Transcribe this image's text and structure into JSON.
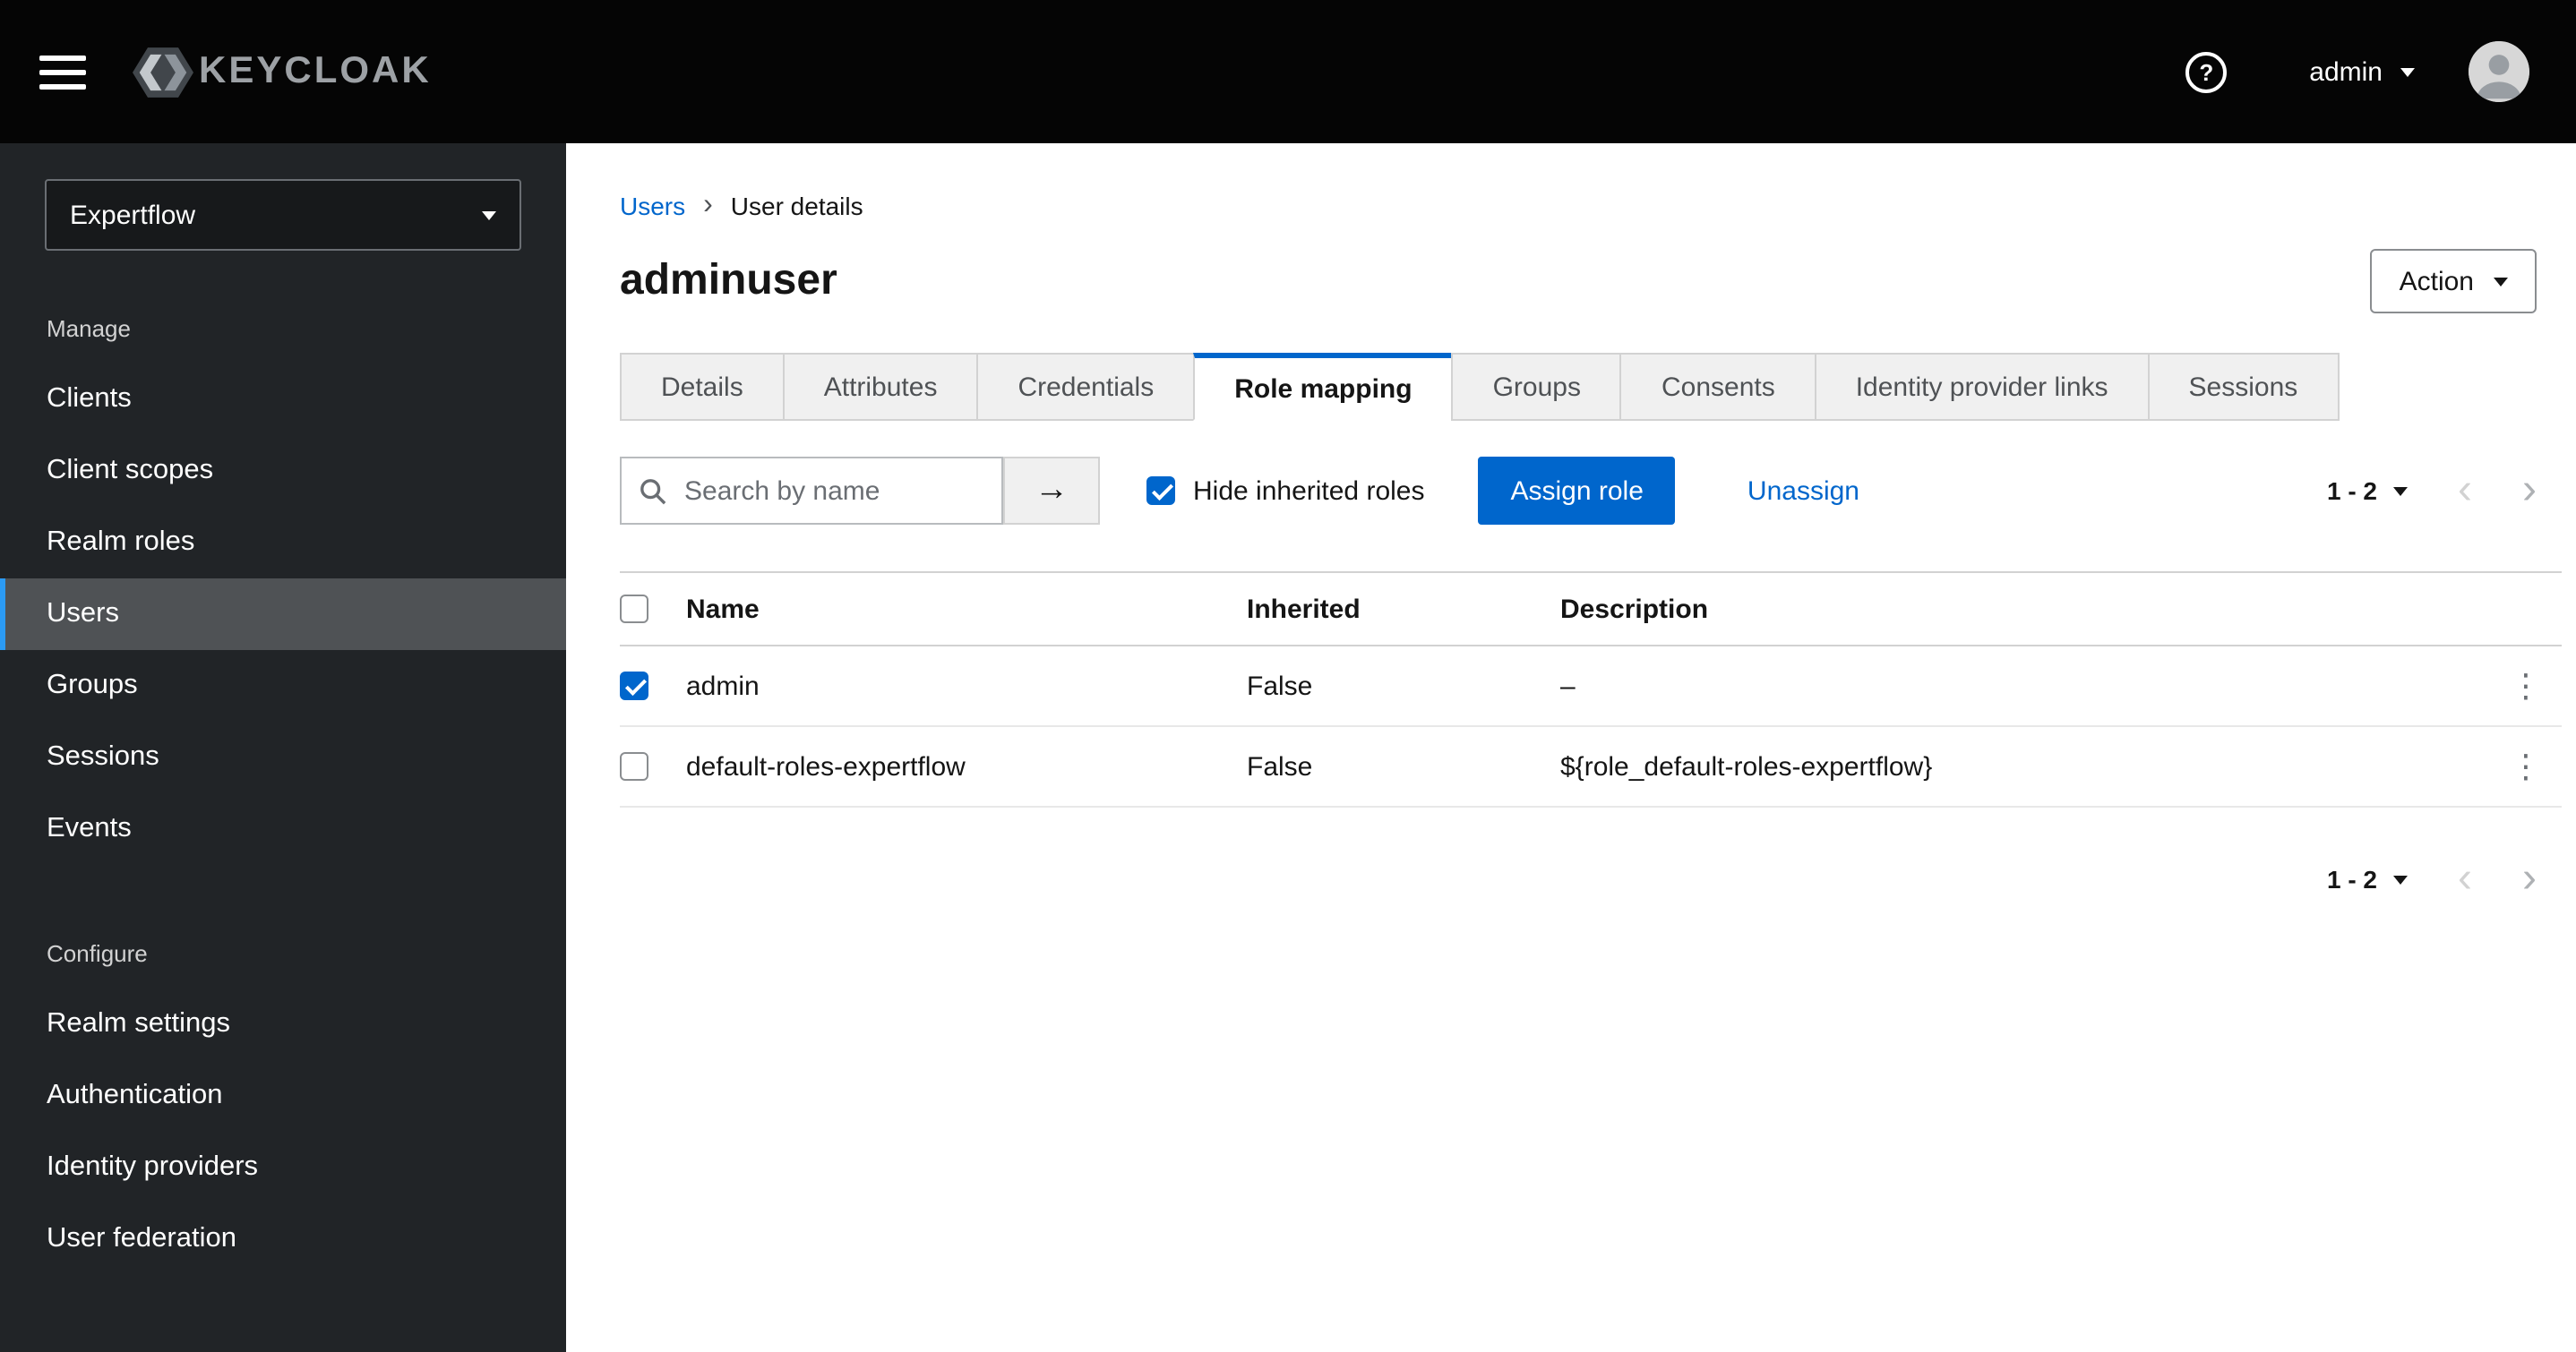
{
  "topbar": {
    "brand": "KEYCLOAK",
    "user": "admin"
  },
  "icons": {
    "question": "?",
    "arrow_right": "→",
    "kebab": "⋮",
    "chevron_left": "‹",
    "chevron_right": "›",
    "breadcrumb_separator": "›"
  },
  "sidebar": {
    "realm": "Expertflow",
    "manage": {
      "label": "Manage",
      "items": [
        "Clients",
        "Client scopes",
        "Realm roles",
        "Users",
        "Groups",
        "Sessions",
        "Events"
      ],
      "active_item": "Users"
    },
    "configure": {
      "label": "Configure",
      "items": [
        "Realm settings",
        "Authentication",
        "Identity providers",
        "User federation"
      ]
    }
  },
  "main": {
    "breadcrumb": {
      "parent": "Users",
      "current": "User details"
    },
    "title": "adminuser",
    "action_label": "Action",
    "tabs": [
      "Details",
      "Attributes",
      "Credentials",
      "Role mapping",
      "Groups",
      "Consents",
      "Identity provider links",
      "Sessions"
    ],
    "active_tab": "Role mapping",
    "toolbar": {
      "search_placeholder": "Search by name",
      "hide_inherited": "Hide inherited roles",
      "hide_inherited_checked": true,
      "assign": "Assign role",
      "unassign": "Unassign",
      "pagination": "1 - 2"
    },
    "table": {
      "headers": [
        "Name",
        "Inherited",
        "Description"
      ],
      "rows": [
        {
          "name": "admin",
          "checked": true,
          "inherited": "False",
          "description": "–"
        },
        {
          "name": "default-roles-expertflow",
          "checked": false,
          "inherited": "False",
          "description": "${role_default-roles-expertflow}"
        }
      ]
    },
    "pagination_bottom": "1 - 2"
  }
}
